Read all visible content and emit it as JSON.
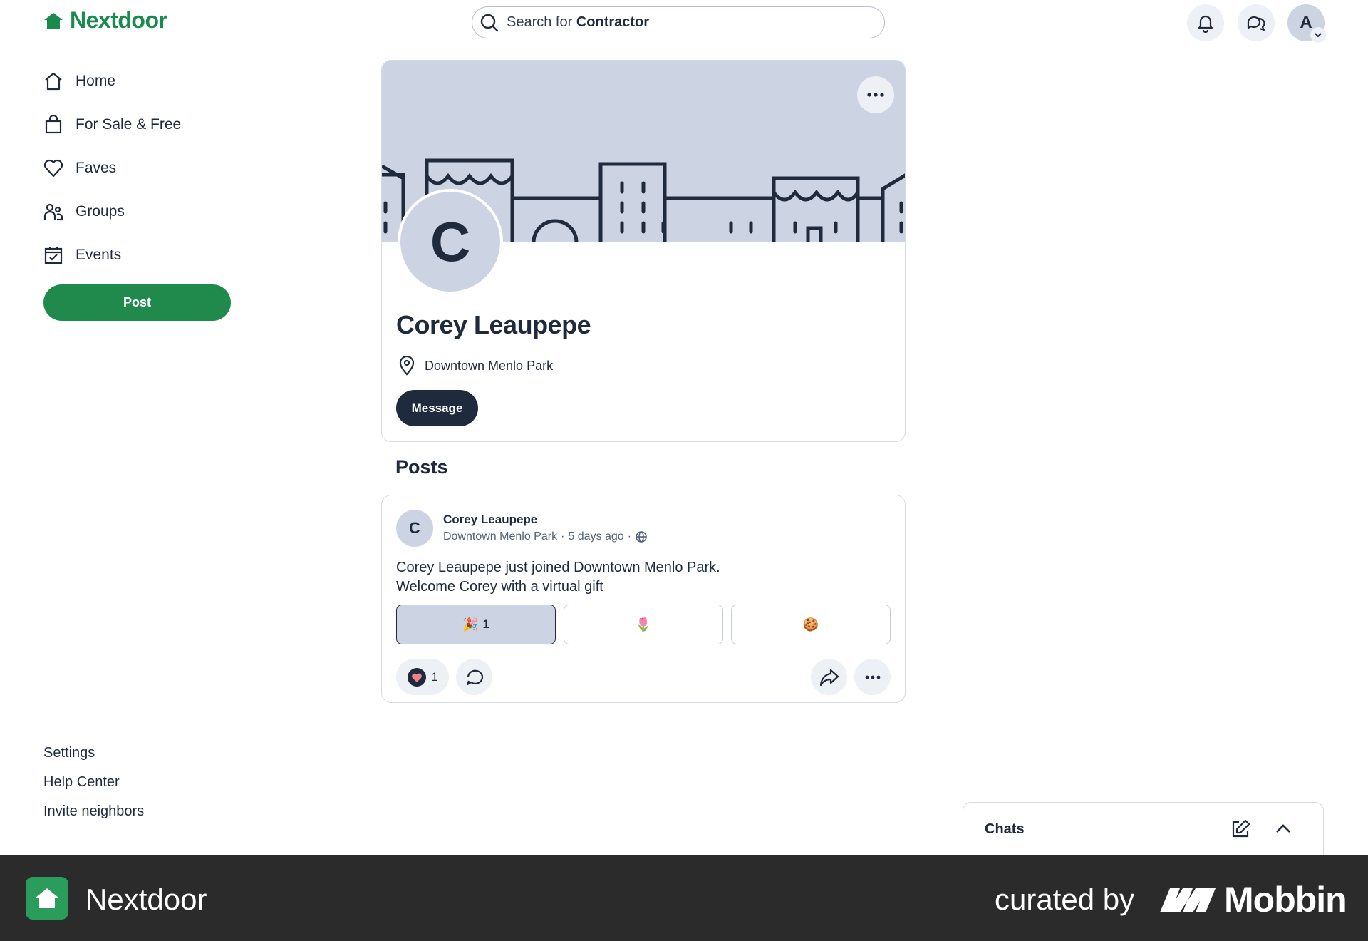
{
  "app": {
    "name": "Nextdoor",
    "brand_color": "#1a8a4f"
  },
  "search": {
    "prefix": "Search for ",
    "keyword": "Contractor"
  },
  "topbar": {
    "avatar_initial": "A"
  },
  "sidebar": {
    "items": [
      {
        "label": "Home",
        "icon": "home-icon"
      },
      {
        "label": "For Sale & Free",
        "icon": "shopping-bag-icon"
      },
      {
        "label": "Faves",
        "icon": "heart-icon"
      },
      {
        "label": "Groups",
        "icon": "groups-icon"
      },
      {
        "label": "Events",
        "icon": "calendar-icon"
      }
    ],
    "post_label": "Post",
    "footer_links": [
      "Settings",
      "Help Center",
      "Invite neighbors"
    ]
  },
  "profile": {
    "initial": "C",
    "name": "Corey Leaupepe",
    "location": "Downtown Menlo Park",
    "message_label": "Message"
  },
  "posts": {
    "heading": "Posts",
    "items": [
      {
        "initial": "C",
        "author": "Corey Leaupepe",
        "neighborhood": "Downtown Menlo Park",
        "separator": "·",
        "time": "5 days ago",
        "body_line1": "Corey Leaupepe just joined Downtown Menlo Park.",
        "body_line2": "Welcome Corey with a virtual gift",
        "gifts": [
          {
            "emoji": "🎉",
            "count": "1"
          },
          {
            "emoji": "🌷",
            "count": ""
          },
          {
            "emoji": "🍪",
            "count": ""
          }
        ],
        "reaction_count": "1"
      }
    ]
  },
  "chats": {
    "title": "Chats"
  },
  "banner": {
    "app_name": "Nextdoor",
    "curated_by": "curated by",
    "brand": "Mobbin"
  }
}
